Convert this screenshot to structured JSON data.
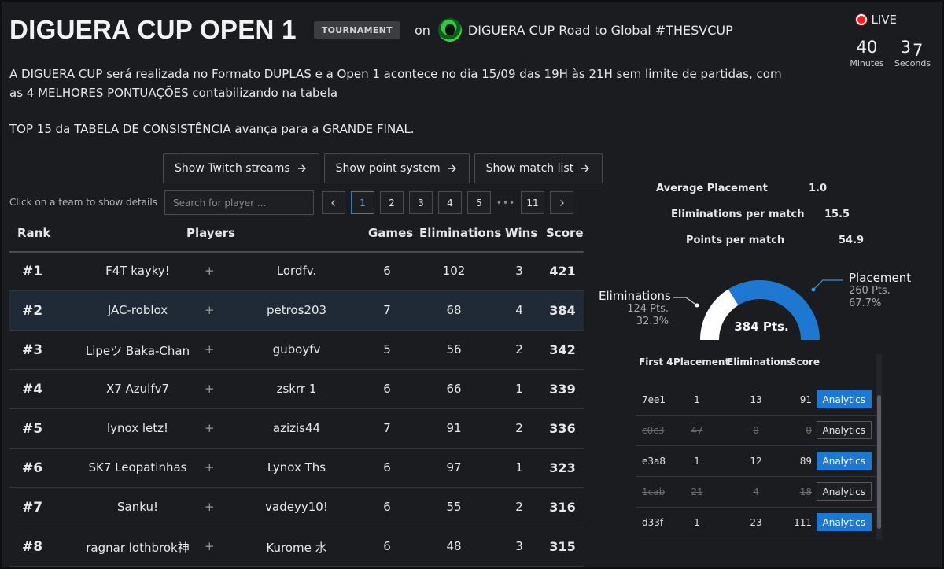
{
  "header": {
    "title": "DIGUERA CUP OPEN 1",
    "badge": "TOURNAMENT",
    "on": "on",
    "organizer": "DIGUERA CUP Road to Global #THESVCUP",
    "organizer_icon": "organizer-logo-icon"
  },
  "live": {
    "label": "LIVE",
    "minutes_value": "40",
    "minutes_label": "Minutes",
    "seconds_first": "3",
    "seconds_second": "7",
    "seconds_label": "Seconds"
  },
  "description": {
    "line1": "A DIGUERA CUP será realizada no Formato DUPLAS e a Open 1 acontece no dia 15/09 das 19H às 21H sem limite de partidas, com as 4 MELHORES PONTUAÇÕES contabilizando na tabela",
    "line2": "TOP 15 da TABELA DE CONSISTÊNCIA avança para a GRANDE FINAL."
  },
  "actions": [
    {
      "label": "Show Twitch streams"
    },
    {
      "label": "Show point system"
    },
    {
      "label": "Show match list"
    }
  ],
  "hint": "Click on a team to show details",
  "search": {
    "placeholder": "Search for player ..."
  },
  "pagination": {
    "pages": [
      "1",
      "2",
      "3",
      "4",
      "5"
    ],
    "ellipsis": "•••",
    "last": "11",
    "active": "1"
  },
  "table": {
    "headers": {
      "rank": "Rank",
      "players": "Players",
      "games": "Games",
      "eliminations": "Eliminations",
      "wins": "Wins",
      "score": "Score"
    },
    "rows": [
      {
        "rank": "#1",
        "p1": "F4T kayky!",
        "p2": "Lordfv.",
        "games": "6",
        "elims": "102",
        "wins": "3",
        "score": "421"
      },
      {
        "rank": "#2",
        "p1": "JAC-roblox",
        "p2": "petros203",
        "games": "7",
        "elims": "68",
        "wins": "4",
        "score": "384"
      },
      {
        "rank": "#3",
        "p1": "Lipeツ Baka-Chan",
        "p2": "guboyfv",
        "games": "5",
        "elims": "56",
        "wins": "2",
        "score": "342"
      },
      {
        "rank": "#4",
        "p1": "X7 Azulfv7",
        "p2": "zskrr 1",
        "games": "6",
        "elims": "66",
        "wins": "1",
        "score": "339"
      },
      {
        "rank": "#5",
        "p1": "lynox letz!",
        "p2": "azizis44",
        "games": "7",
        "elims": "91",
        "wins": "2",
        "score": "336"
      },
      {
        "rank": "#6",
        "p1": "SK7 Leopatinhas",
        "p2": "Lynox Ths",
        "games": "6",
        "elims": "97",
        "wins": "1",
        "score": "323"
      },
      {
        "rank": "#7",
        "p1": "Sanku!",
        "p2": "vadeyy10!",
        "games": "6",
        "elims": "55",
        "wins": "2",
        "score": "316"
      },
      {
        "rank": "#8",
        "p1": "ragnar lothbrok神",
        "p2": "Kurome 水",
        "games": "6",
        "elims": "48",
        "wins": "3",
        "score": "315"
      }
    ],
    "plus": "+"
  },
  "details": {
    "avg_placement_label": "Average Placement",
    "avg_placement_value": "1.0",
    "elim_per_match_label": "Eliminations per match",
    "elim_per_match_value": "15.5",
    "points_per_match_label": "Points per match",
    "points_per_match_value": "54.9",
    "gauge": {
      "total": "384 Pts.",
      "elim_label": "Eliminations",
      "elim_pts": "124 Pts.",
      "elim_pct": "32.3%",
      "elim_fraction": 0.323,
      "place_label": "Placement",
      "place_pts": "260 Pts.",
      "place_pct": "67.7%",
      "place_fraction": 0.677,
      "elim_color": "#ffffff",
      "place_color": "#1e78d2"
    },
    "matches": {
      "headers": {
        "first": "First 4",
        "placement": "Placement",
        "elims": "Eliminations",
        "score": "Score"
      },
      "analytics_label": "Analytics",
      "rows": [
        {
          "id": "7ee1",
          "placement": "1",
          "elims": "13",
          "score": "91",
          "counted": true
        },
        {
          "id": "c0c3",
          "placement": "47",
          "elims": "0",
          "score": "0",
          "counted": false
        },
        {
          "id": "e3a8",
          "placement": "1",
          "elims": "12",
          "score": "89",
          "counted": true
        },
        {
          "id": "1cab",
          "placement": "21",
          "elims": "4",
          "score": "18",
          "counted": false
        },
        {
          "id": "d33f",
          "placement": "1",
          "elims": "23",
          "score": "111",
          "counted": true
        }
      ]
    }
  }
}
